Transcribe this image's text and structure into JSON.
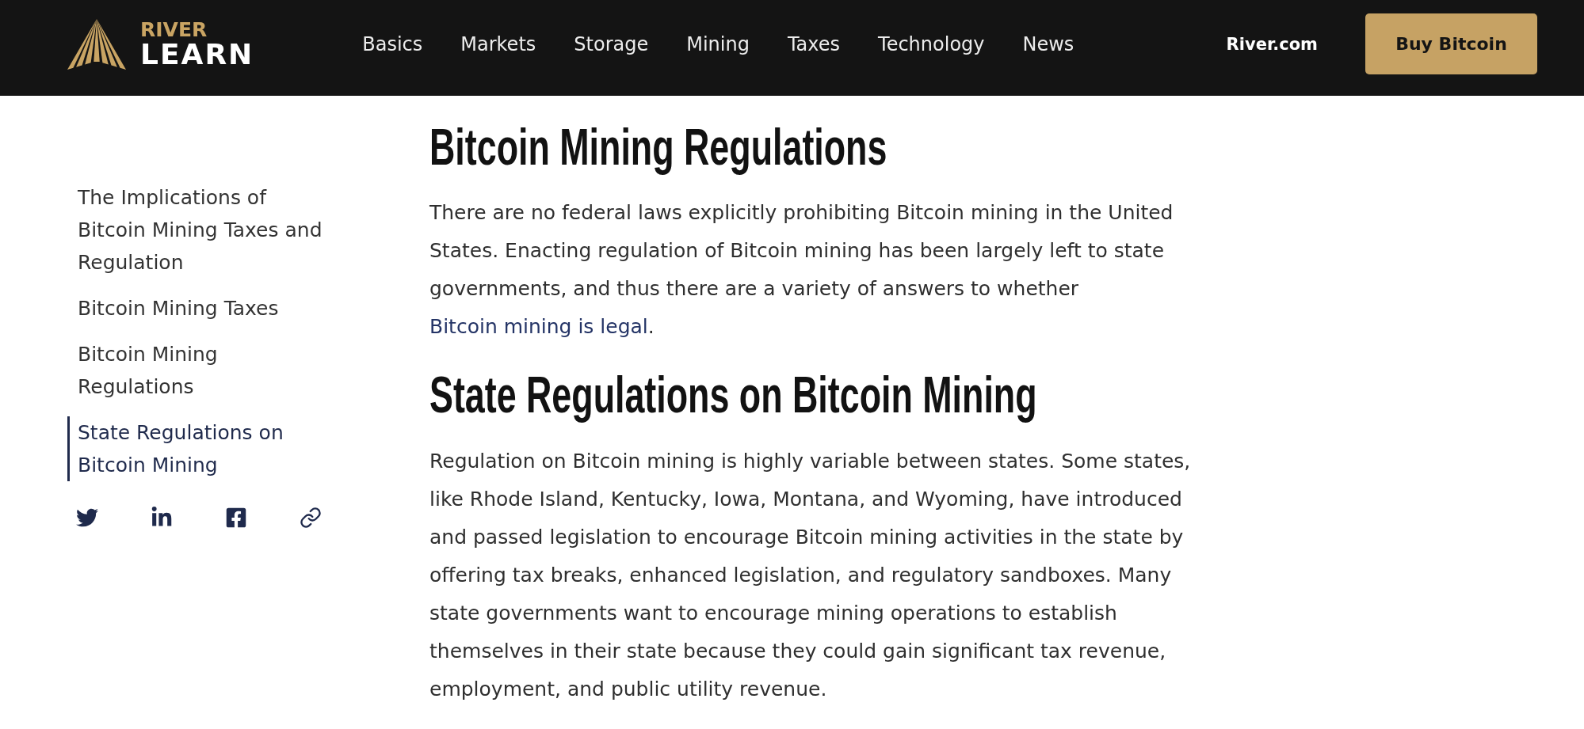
{
  "header": {
    "brand": {
      "name": "RIVER",
      "section": "LEARN"
    },
    "nav": [
      "Basics",
      "Markets",
      "Storage",
      "Mining",
      "Taxes",
      "Technology",
      "News"
    ],
    "site_link": "River.com",
    "cta_button": "Buy Bitcoin"
  },
  "sidebar": {
    "items": [
      {
        "label": "The Implications of Bitcoin Mining Taxes and Regulation",
        "selected": false
      },
      {
        "label": "Bitcoin Mining Taxes",
        "selected": false
      },
      {
        "label": "Bitcoin Mining Regulations",
        "selected": false
      },
      {
        "label": "State Regulations on Bitcoin Mining",
        "selected": true
      }
    ]
  },
  "article": {
    "sections": [
      {
        "heading": "Bitcoin Mining Regulations",
        "paragraph": [
          {
            "kind": "text",
            "text": "There are no federal laws explicitly prohibiting Bitcoin mining in the United States. Enacting regulation of Bitcoin mining has been largely left to state governments, and thus there are a variety of answers to whether "
          },
          {
            "kind": "link",
            "text": "Bitcoin mining is legal"
          },
          {
            "kind": "text",
            "text": "."
          }
        ]
      },
      {
        "heading": "State Regulations on Bitcoin Mining",
        "paragraph": [
          {
            "kind": "text",
            "text": "Regulation on Bitcoin mining is highly variable between states. Some states, like Rhode Island, Kentucky, Iowa, Montana, and Wyoming, have introduced and passed legislation to encourage Bitcoin mining activities in the state by offering tax breaks, enhanced legislation, and regulatory sandboxes. Many state governments want to encourage mining operations to establish themselves in their state because they could gain significant tax revenue, employment, and public utility revenue."
          }
        ]
      }
    ]
  }
}
